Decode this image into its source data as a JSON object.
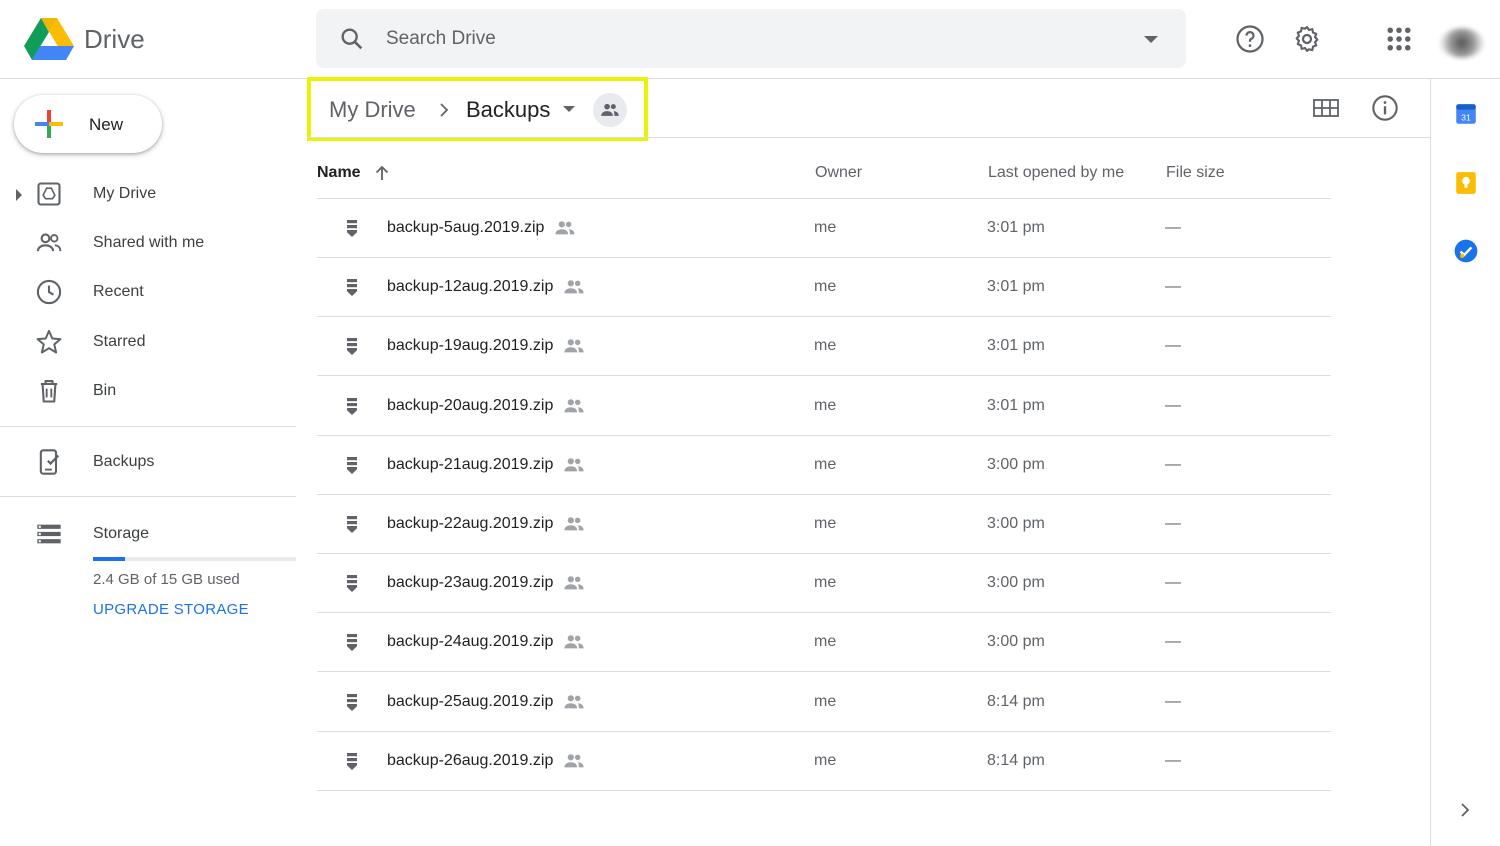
{
  "app": {
    "name": "Drive"
  },
  "search": {
    "placeholder": "Search Drive"
  },
  "header_icons": [
    "help-icon",
    "settings-icon",
    "apps-grid-icon"
  ],
  "sidebar": {
    "new_label": "New",
    "items": [
      {
        "label": "My Drive",
        "icon": "my-drive-icon"
      },
      {
        "label": "Shared with me",
        "icon": "people-icon"
      },
      {
        "label": "Recent",
        "icon": "clock-icon"
      },
      {
        "label": "Starred",
        "icon": "star-icon"
      },
      {
        "label": "Bin",
        "icon": "trash-icon"
      },
      {
        "label": "Backups",
        "icon": "backup-device-icon"
      },
      {
        "label": "Storage",
        "icon": "storage-icon"
      }
    ],
    "storage": {
      "used_text": "2.4 GB of 15 GB used",
      "used_fraction": 0.16,
      "upgrade_label": "UPGRADE STORAGE"
    }
  },
  "breadcrumb": {
    "root": "My Drive",
    "current": "Backups"
  },
  "columns": {
    "name": "Name",
    "owner": "Owner",
    "opened": "Last opened by me",
    "size": "File size"
  },
  "files": [
    {
      "name": "backup-5aug.2019.zip",
      "owner": "me",
      "opened": "3:01 pm",
      "size": "—"
    },
    {
      "name": "backup-12aug.2019.zip",
      "owner": "me",
      "opened": "3:01 pm",
      "size": "—"
    },
    {
      "name": "backup-19aug.2019.zip",
      "owner": "me",
      "opened": "3:01 pm",
      "size": "—"
    },
    {
      "name": "backup-20aug.2019.zip",
      "owner": "me",
      "opened": "3:01 pm",
      "size": "—"
    },
    {
      "name": "backup-21aug.2019.zip",
      "owner": "me",
      "opened": "3:00 pm",
      "size": "—"
    },
    {
      "name": "backup-22aug.2019.zip",
      "owner": "me",
      "opened": "3:00 pm",
      "size": "—"
    },
    {
      "name": "backup-23aug.2019.zip",
      "owner": "me",
      "opened": "3:00 pm",
      "size": "—"
    },
    {
      "name": "backup-24aug.2019.zip",
      "owner": "me",
      "opened": "3:00 pm",
      "size": "—"
    },
    {
      "name": "backup-25aug.2019.zip",
      "owner": "me",
      "opened": "8:14 pm",
      "size": "—"
    },
    {
      "name": "backup-26aug.2019.zip",
      "owner": "me",
      "opened": "8:14 pm",
      "size": "—"
    }
  ],
  "right_rail": [
    "calendar-icon",
    "keep-icon",
    "tasks-icon"
  ],
  "colors": {
    "accent": "#1a73e8",
    "highlight_border": "#ebf206"
  }
}
